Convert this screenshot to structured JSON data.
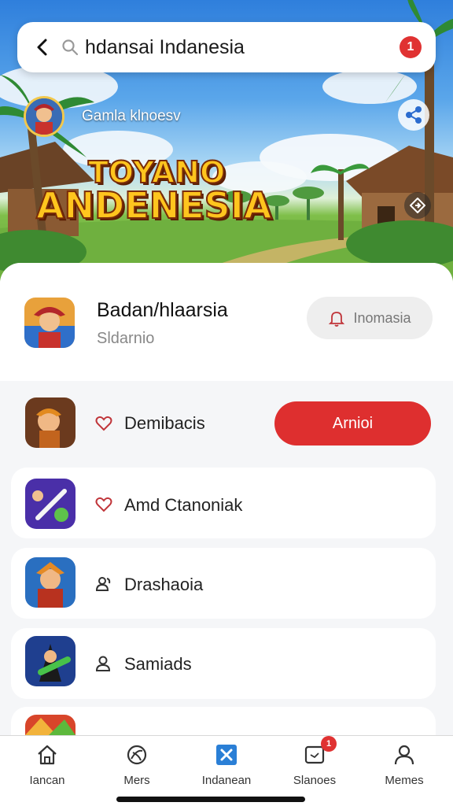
{
  "search": {
    "query": "hdansai Indanesia",
    "badge": "1"
  },
  "hero": {
    "channel_name": "Gamla klnoesv",
    "logo_line1": "TOYANO",
    "logo_line2": "ANDENESIA"
  },
  "header": {
    "title": "Badan/hlaarsia",
    "subtitle": "Sldarnio",
    "pill_label": "Inomasia"
  },
  "rows": [
    {
      "label": "Demibacis",
      "icon": "heart-icon",
      "action_label": "Arnioi"
    },
    {
      "label": "Amd Ctanoniak",
      "icon": "heart-icon"
    },
    {
      "label": "Drashaoia",
      "icon": "group-icon"
    },
    {
      "label": "Samiads",
      "icon": "person-icon"
    }
  ],
  "nav": [
    {
      "label": "Iancan",
      "icon": "home-icon"
    },
    {
      "label": "Mers",
      "icon": "globe-icon"
    },
    {
      "label": "Indanean",
      "icon": "x-square-icon",
      "active": true
    },
    {
      "label": "Slanoes",
      "icon": "notification-icon",
      "badge": "1"
    },
    {
      "label": "Memes",
      "icon": "profile-icon"
    }
  ],
  "colors": {
    "accent": "#de2f2f",
    "active_nav": "#2a7fd6",
    "sky": "#2f7fdc"
  }
}
